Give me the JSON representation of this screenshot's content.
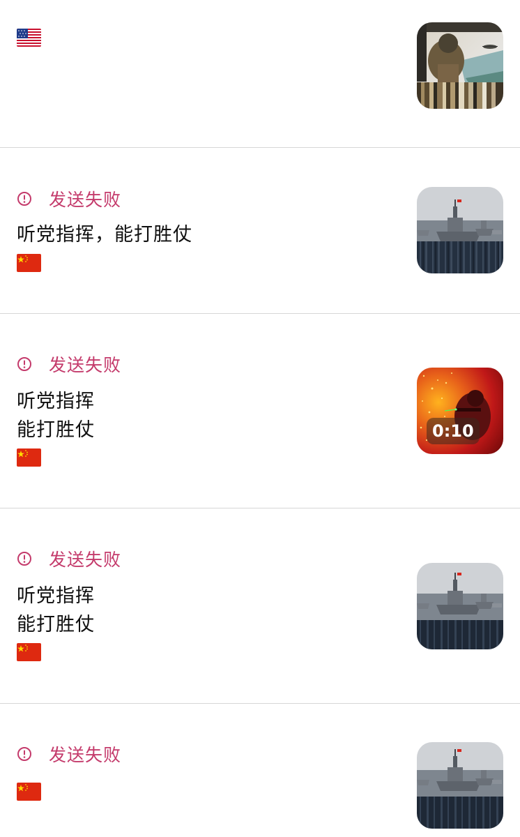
{
  "items": [
    {
      "status": "",
      "text_lines": [],
      "flag_icon": "us-flag-icon",
      "media_type": "image",
      "media_icon": "soldier-helicopter-photo"
    },
    {
      "status": "发送失败",
      "text_lines": [
        "听党指挥，能打胜仗"
      ],
      "flag_icon": "cn-flag-icon",
      "media_type": "image",
      "media_icon": "warship-photo"
    },
    {
      "status": "发送失败",
      "text_lines": [
        "听党指挥",
        "能打胜仗"
      ],
      "flag_icon": "cn-flag-icon",
      "media_type": "video",
      "media_icon": "soldier-sparks-video",
      "duration": "0:10"
    },
    {
      "status": "发送失败",
      "text_lines": [
        "听党指挥",
        "能打胜仗"
      ],
      "flag_icon": "cn-flag-icon",
      "media_type": "image",
      "media_icon": "warship-photo"
    },
    {
      "status": "发送失败",
      "text_lines": [],
      "flag_icon": "cn-flag-icon",
      "media_type": "image",
      "media_icon": "warship-photo"
    }
  ],
  "colors": {
    "status_red": "#c43a6b",
    "divider": "#d6d6d6",
    "text": "#111111"
  }
}
